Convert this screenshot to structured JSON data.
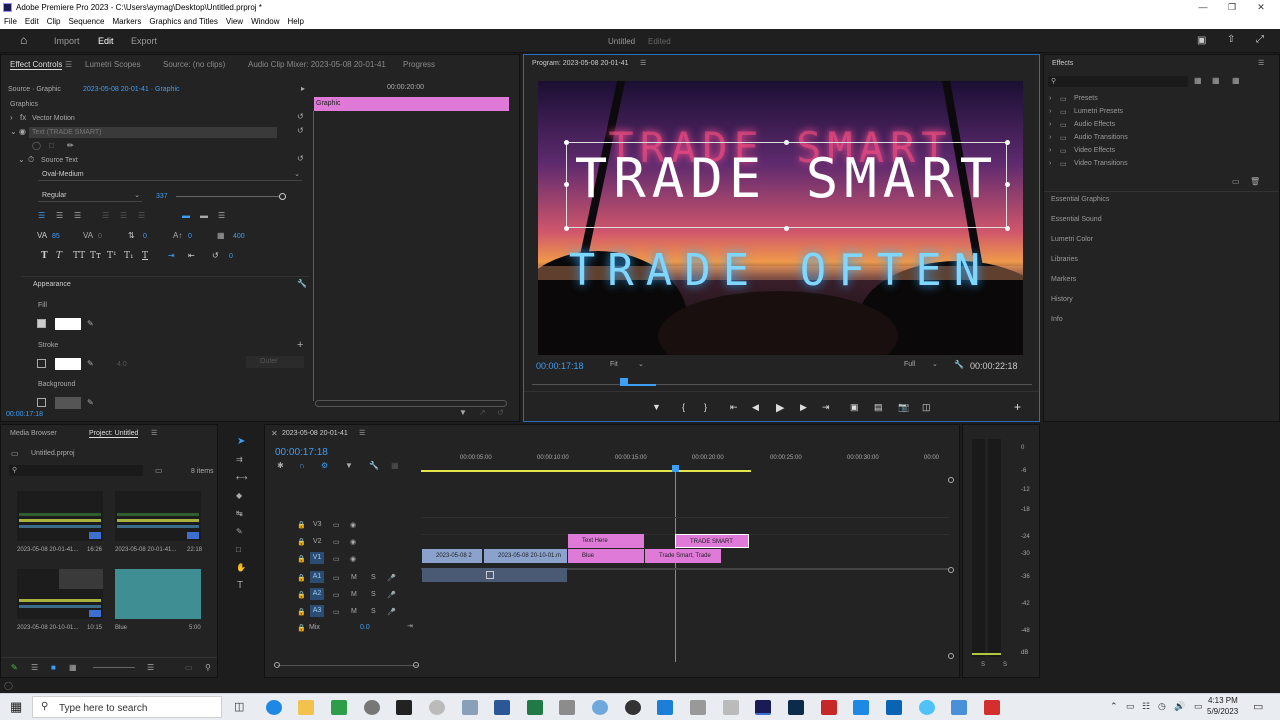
{
  "window": {
    "title": "Adobe Premiere Pro 2023 - C:\\Users\\aymag\\Desktop\\Untitled.prproj *"
  },
  "menu": [
    "File",
    "Edit",
    "Clip",
    "Sequence",
    "Markers",
    "Graphics and Titles",
    "View",
    "Window",
    "Help"
  ],
  "workspace": {
    "tabs": [
      "Import",
      "Edit",
      "Export"
    ],
    "project_name": "Untitled",
    "project_status": "Edited"
  },
  "effect_controls": {
    "tabs": [
      "Effect Controls",
      "Lumetri Scopes",
      "Source: (no clips)",
      "Audio Clip Mixer: 2023-05-08 20-01-41",
      "Progress"
    ],
    "source": "Source · Graphic",
    "sequence": "2023-05-08 20-01-41 · Graphic",
    "ruler_time": "00:00:20:00",
    "clip_label": "Graphic",
    "section": "Graphics",
    "vector_motion": "Vector Motion",
    "text_layer": "Text (TRADE SMART)",
    "source_text": "Source Text",
    "font": "Oval-Medium",
    "style": "Regular",
    "font_size": "337",
    "tracking": "85",
    "kerning": "0",
    "leading": "0",
    "baseline": "0",
    "tsume": "400",
    "rotate": "0",
    "appearance": "Appearance",
    "fill": "Fill",
    "stroke": "Stroke",
    "stroke_width": "4.0",
    "stroke_mode": "Outer",
    "background": "Background",
    "timecode": "00:00:17:18"
  },
  "program": {
    "tab": "Program: 2023-05-08 20-01-41",
    "timecode": "00:00:17:18",
    "fit": "Fit",
    "quality": "Full",
    "duration": "00:00:22:18",
    "line1": "TRADE SMART",
    "line2": "TRADE OFTEN"
  },
  "effects_panel": {
    "title": "Effects",
    "items": [
      "Presets",
      "Lumetri Presets",
      "Audio Effects",
      "Audio Transitions",
      "Video Effects",
      "Video Transitions"
    ],
    "side": [
      "Essential Graphics",
      "Essential Sound",
      "Lumetri Color",
      "Libraries",
      "Markers",
      "History",
      "Info"
    ]
  },
  "project": {
    "tabs": [
      "Media Browser",
      "Project: Untitled"
    ],
    "file": "Untitled.prproj",
    "count": "8 items",
    "thumbs": [
      {
        "name": "2023-05-08 20-01-41...",
        "dur": "16:26"
      },
      {
        "name": "2023-05-08 20-01-41...",
        "dur": "22:18"
      },
      {
        "name": "2023-05-08 20-10-01...",
        "dur": "10:15"
      },
      {
        "name": "Blue",
        "dur": "5:00"
      }
    ]
  },
  "timeline": {
    "tab": "2023-05-08 20-01-41",
    "timecode": "00:00:17:18",
    "ruler": [
      "00:00:05:00",
      "00:00:10:00",
      "00:00:15:00",
      "00:00:20:00",
      "00:00:25:00",
      "00:00:30:00",
      "00:00"
    ],
    "video_tracks": [
      "V3",
      "V2",
      "V1"
    ],
    "audio_tracks": [
      "A1",
      "A2",
      "A3"
    ],
    "mix": "Mix",
    "mix_val": "0.0",
    "clips": {
      "text_here": "Text Here",
      "trade_smart": "TRADE SMART",
      "v1a": "2023-05-08 2",
      "v1b": "2023-05-08 20-10-01.m",
      "blue": "Blue",
      "v1d": "Trade Smart, Trade"
    },
    "meter": [
      "0",
      "-6",
      "-12",
      "-18",
      "-24",
      "-30",
      "-36",
      "-42",
      "-48",
      "dB"
    ],
    "meter_solo": [
      "S",
      "S"
    ]
  },
  "taskbar": {
    "search": "Type here to search",
    "time": "4:13 PM",
    "date": "5/9/2023"
  }
}
